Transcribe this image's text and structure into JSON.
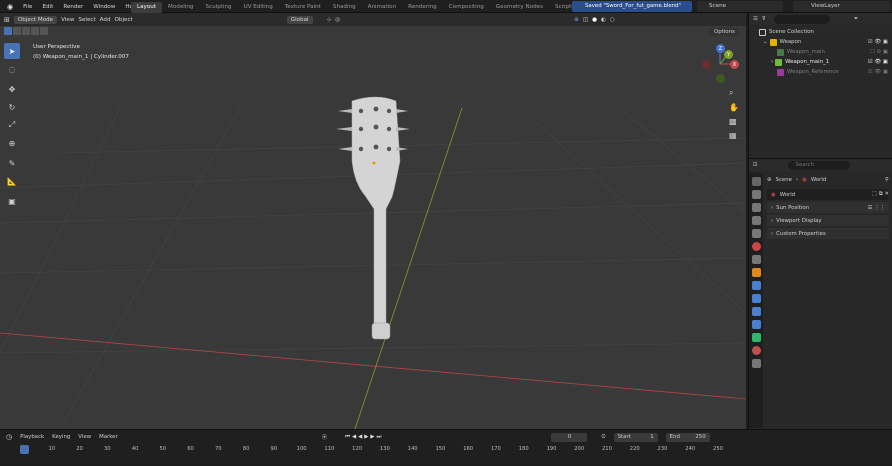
{
  "menu": [
    "File",
    "Edit",
    "Render",
    "Window",
    "Help"
  ],
  "workspaces": [
    "Layout",
    "Modeling",
    "Sculpting",
    "UV Editing",
    "Texture Paint",
    "Shading",
    "Animation",
    "Rendering",
    "Compositing",
    "Geometry Nodes",
    "Scripting",
    "+"
  ],
  "status_message": "Saved \"Sword_For_fut_game.blend\"",
  "scene_name": "Scene",
  "view_layer": "ViewLayer",
  "viewport_header": {
    "mode": "Object Mode",
    "view": "View",
    "select": "Select",
    "add": "Add",
    "object": "Object",
    "transform": "Global",
    "options": "Options"
  },
  "viewport_info": {
    "perspective": "User Perspective",
    "object": "(0) Weapon_main_1 | Cylinder.007"
  },
  "gizmo_axes": {
    "x": "X",
    "y": "Y",
    "z": "Z"
  },
  "outliner": {
    "search_placeholder": "",
    "root": "Scene Collection",
    "collection": "Weapon",
    "items": [
      "Weapon_main",
      "Weapon_main_1",
      "Weapon_Reference"
    ]
  },
  "properties": {
    "search_placeholder": "Search",
    "breadcrumb_scene": "Scene",
    "breadcrumb_world": "World",
    "world_name": "World",
    "panels": [
      "Sun Position",
      "Viewport Display",
      "Custom Properties"
    ]
  },
  "timeline": {
    "playback": "Playback",
    "keying": "Keying",
    "view": "View",
    "marker": "Marker",
    "current_frame": "0",
    "start_label": "Start",
    "start": "1",
    "end_label": "End",
    "end": "250",
    "ticks": [
      "0",
      "10",
      "20",
      "30",
      "40",
      "50",
      "60",
      "70",
      "80",
      "90",
      "100",
      "110",
      "120",
      "130",
      "140",
      "150",
      "160",
      "170",
      "180",
      "190",
      "200",
      "210",
      "220",
      "230",
      "240",
      "250"
    ]
  },
  "colors": {
    "accent": "#4772b3",
    "x_axis": "#c24a4a",
    "y_axis": "#8fa232",
    "grid": "#444444"
  }
}
